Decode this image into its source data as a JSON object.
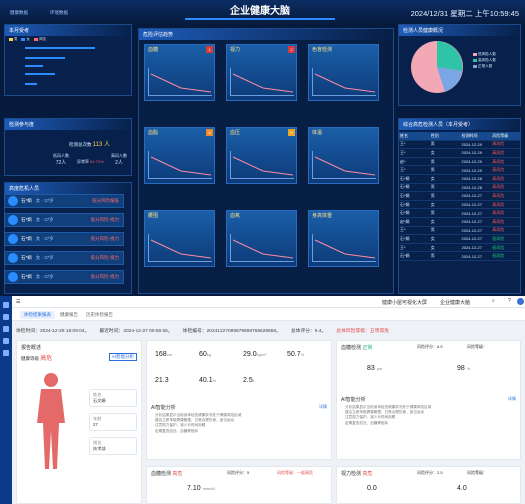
{
  "dashboard": {
    "title": "企业健康大脑",
    "datetime": "2024/12/31 星期二 上午10:59:45",
    "tabs": [
      "健康数据",
      "环境数据"
    ],
    "sections": {
      "this_month": "本月受考",
      "checkup": "检测参与度",
      "high_risk": "高度危机人员",
      "risk_trend": "危险评估趋势",
      "overview": "检测人员健康概况",
      "combined": "综合高危检测人员（本月受考）"
    },
    "checkup_stats": {
      "total_label": "检测总次数",
      "total": "113 人",
      "low_label": "低风人数",
      "low": "72人",
      "pct_label": "异常率",
      "pct": "61.72%",
      "high_label": "高风人数",
      "high": "2人"
    },
    "cards": [
      {
        "title": "血糖",
        "badge": "1"
      },
      {
        "title": "视力",
        "badge": "2"
      },
      {
        "title": "色盲检测",
        "badge": ""
      },
      {
        "title": "血脂",
        "badge": "4"
      },
      {
        "title": "血压",
        "badge": "5"
      },
      {
        "title": "体温",
        "badge": ""
      },
      {
        "title": "腰围",
        "badge": ""
      },
      {
        "title": "血氧",
        "badge": ""
      },
      {
        "title": "身高体重",
        "badge": ""
      }
    ],
    "persons": [
      {
        "name": "石*娟",
        "age": "女 · 27岁",
        "risk": "低分风险偏低"
      },
      {
        "name": "石*娟",
        "age": "女 · 27岁",
        "risk": "低分风险-视力"
      },
      {
        "name": "石*娟",
        "age": "女 · 27岁",
        "risk": "低分风险-视力"
      },
      {
        "name": "石*娟",
        "age": "女 · 27岁",
        "risk": "低分风险-视力"
      },
      {
        "name": "石*娟",
        "age": "女 · 27岁",
        "risk": "低分风险-视力"
      }
    ],
    "table": {
      "headers": [
        "姓名",
        "性别",
        "检测时间",
        "风险等级"
      ],
      "rows": [
        [
          "王*",
          "男",
          "2024-12-29",
          "高风险"
        ],
        [
          "王*",
          "女",
          "2024-12-29",
          "高风险"
        ],
        [
          "赵*",
          "男",
          "2024-12-29",
          "高风险"
        ],
        [
          "王*",
          "男",
          "2024-12-29",
          "高风险"
        ],
        [
          "石*娟",
          "女",
          "2024-12-28",
          "高风险"
        ],
        [
          "石*娟",
          "男",
          "2024-12-28",
          "高风险"
        ],
        [
          "石*娟",
          "男",
          "2024-12-27",
          "高风险"
        ],
        [
          "石*娟",
          "女",
          "2024-12-27",
          "高风险"
        ],
        [
          "石*娟",
          "男",
          "2024-12-27",
          "高风险"
        ],
        [
          "赵*娟",
          "女",
          "2024-12-27",
          "高风险"
        ],
        [
          "王*",
          "男",
          "2024-12-27",
          "高风险"
        ],
        [
          "石*娟",
          "女",
          "2024-12-27",
          "低风险"
        ],
        [
          "王*",
          "女",
          "2024-12-27",
          "低风险"
        ],
        [
          "石*娟",
          "男",
          "2024-12-27",
          "低风险"
        ]
      ]
    },
    "pie_legend": [
      "低风险人数",
      "高风险人数",
      "正常人数"
    ]
  },
  "app": {
    "brand": "健康小屋可视化大屏",
    "brand2": "企业健康大脑",
    "tabs": [
      "体检结果报表",
      "健康报告",
      "历史体检报告"
    ],
    "info": {
      "first": "体检时间：2024-12-28 18:09:04。",
      "last": "最近时间：2024-12-27 09:56:55。",
      "report": "体检编号：20241227089879698765628658。",
      "score": "总体评分：9.4。",
      "risk": "总体风险等级：五项高危"
    },
    "report_title": "报告概述",
    "health": {
      "label": "健康等级",
      "value": "高危",
      "link": "AI智能分析"
    },
    "profile": [
      {
        "k": "姓名",
        "v": "石文娟"
      },
      {
        "k": "年龄",
        "v": "27"
      },
      {
        "k": "岗位",
        "v": "技术部"
      }
    ],
    "metrics": [
      {
        "v": "168",
        "u": "cm"
      },
      {
        "v": "60",
        "u": "kg"
      },
      {
        "v": "29.0",
        "u": "kg/m²"
      },
      {
        "v": "50.7",
        "u": "%"
      },
      {
        "v": "21.3",
        "u": ""
      },
      {
        "v": "40.1",
        "u": "%"
      },
      {
        "v": "2.5",
        "u": "L"
      }
    ],
    "ai_title": "AI智能分析",
    "ai_text": [
      "分析结果显示当前身体检查健康状况处于健康风险区域",
      "建议立即采取健康管理，日常合理饮食，适当运动",
      "注意视力保护，减少长时间用眼",
      "定期复查血压、血糖等指标"
    ],
    "right": {
      "title": "血糖检测",
      "status": "正常",
      "score_label": "风险评分：8.5",
      "level_label": "风险等级：",
      "v1": "83",
      "u1": "μm",
      "v2": "98",
      "u2": "%",
      "ai_title": "AI智能分析"
    },
    "bottom_left": {
      "title": "血糖检测",
      "status": "高危",
      "score": "风险评分：5",
      "level": "风险等级：一般高危",
      "v": "7.10",
      "u": "mmol/L"
    },
    "bottom_right": {
      "title": "视力检测",
      "status": "高危",
      "score": "风险评分：2.5",
      "level": "风险等级：",
      "v1": "0.0",
      "v2": "4.0"
    },
    "more_label": "详情",
    "charts_label": "体型外貌趋势"
  }
}
